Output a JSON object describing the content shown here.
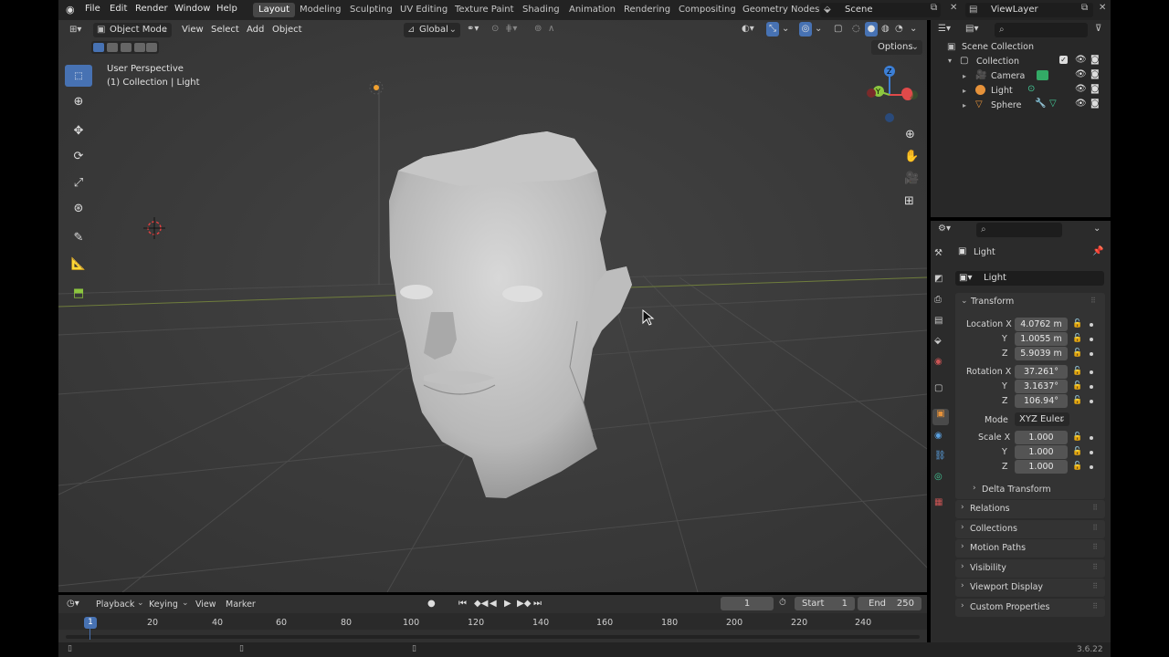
{
  "menu": {
    "file": "File",
    "edit": "Edit",
    "render": "Render",
    "window": "Window",
    "help": "Help"
  },
  "workspaces": [
    "Layout",
    "Modeling",
    "Sculpting",
    "UV Editing",
    "Texture Paint",
    "Shading",
    "Animation",
    "Rendering",
    "Compositing",
    "Geometry Nodes"
  ],
  "scene": "Scene",
  "view_layer": "ViewLayer",
  "viewport": {
    "mode": "Object Mode",
    "view_menu": "View",
    "select_menu": "Select",
    "add_menu": "Add",
    "object_menu": "Object",
    "orientation": "Global",
    "options": "Options",
    "perspective": "User Perspective",
    "context": "(1) Collection | Light"
  },
  "outliner": {
    "scene_collection": "Scene Collection",
    "collection": "Collection",
    "items": [
      "Camera",
      "Light",
      "Sphere"
    ]
  },
  "properties": {
    "object_name": "Light",
    "data_name": "Light",
    "transform_title": "Transform",
    "location_label": "Location X",
    "rotation_label": "Rotation X",
    "scale_label": "Scale X",
    "y": "Y",
    "z": "Z",
    "location": [
      "4.0762 m",
      "1.0055 m",
      "5.9039 m"
    ],
    "rotation": [
      "37.261°",
      "3.1637°",
      "106.94°"
    ],
    "mode_label": "Mode",
    "mode_value": "XYZ Euler",
    "scale": [
      "1.000",
      "1.000",
      "1.000"
    ],
    "delta_transform": "Delta Transform",
    "sections": [
      "Relations",
      "Collections",
      "Motion Paths",
      "Visibility",
      "Viewport Display",
      "Custom Properties"
    ]
  },
  "timeline": {
    "playback": "Playback",
    "keying": "Keying",
    "view": "View",
    "marker": "Marker",
    "current_frame": "1",
    "start_label": "Start",
    "start_value": "1",
    "end_label": "End",
    "end_value": "250",
    "ticks": [
      "20",
      "40",
      "60",
      "80",
      "100",
      "120",
      "140",
      "160",
      "180",
      "200",
      "220",
      "240"
    ],
    "playhead": "1"
  },
  "version": "3.6.22",
  "colors": {
    "accent": "#4772b3",
    "x_axis": "#e04a4a",
    "y_axis": "#8cc63f",
    "z_axis": "#3c7fd6",
    "object_orange": "#e6923a"
  }
}
